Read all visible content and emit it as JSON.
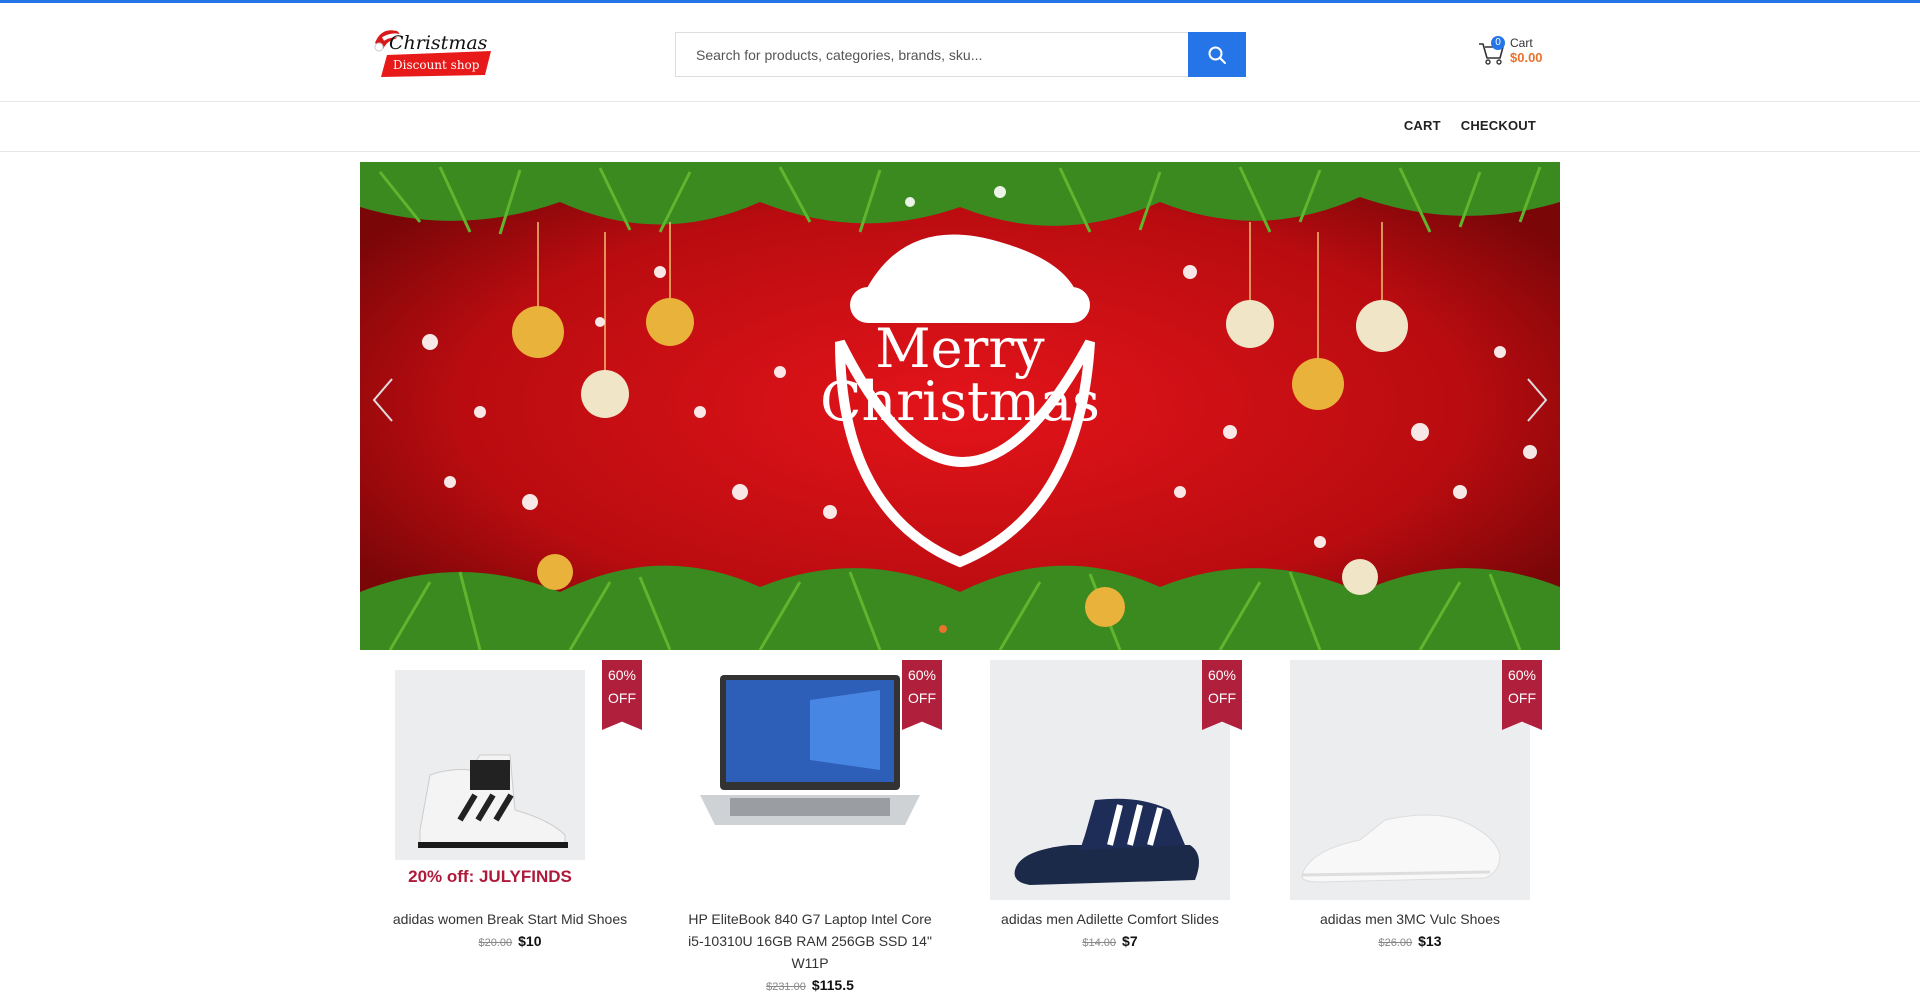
{
  "header": {
    "logo_title": "Christmas",
    "logo_subtitle": "Discount shop",
    "search_placeholder": "Search for products, categories, brands, sku...",
    "cart_count": "0",
    "cart_label": "Cart",
    "cart_total": "$0.00"
  },
  "nav": {
    "items": [
      {
        "label": "CART"
      },
      {
        "label": "CHECKOUT"
      }
    ]
  },
  "banner": {
    "text_line1": "Merry",
    "text_line2": "Christmas"
  },
  "products": [
    {
      "name": "adidas women Break Start Mid Shoes",
      "old_price": "$20.00",
      "price": "$10",
      "badge_line1": "60%",
      "badge_line2": "OFF",
      "promo": "20% off: JULYFINDS"
    },
    {
      "name": "HP EliteBook 840 G7 Laptop Intel Core i5-10310U 16GB RAM 256GB SSD 14\" W11P",
      "old_price": "$231.00",
      "price": "$115.5",
      "badge_line1": "60%",
      "badge_line2": "OFF"
    },
    {
      "name": "adidas men Adilette Comfort Slides",
      "old_price": "$14.00",
      "price": "$7",
      "badge_line1": "60%",
      "badge_line2": "OFF"
    },
    {
      "name": "adidas men 3MC Vulc Shoes",
      "old_price": "$26.00",
      "price": "$13",
      "badge_line1": "60%",
      "badge_line2": "OFF"
    }
  ],
  "colors": {
    "accent": "#2575e8",
    "cart_total": "#e8732e",
    "badge": "#b0203c",
    "banner_bg": "#c9100e"
  }
}
